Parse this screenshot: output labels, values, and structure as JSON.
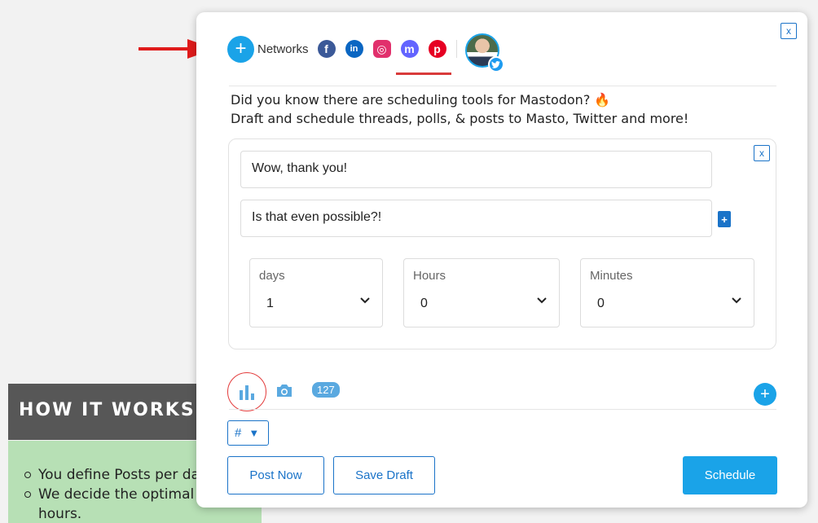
{
  "background_panel": {
    "title": "HOW IT WORKS",
    "items": [
      "You define Posts per day",
      "We decide the optimal d",
      "hours."
    ]
  },
  "composer": {
    "close_label": "x",
    "networks_label": "Networks",
    "add_network_symbol": "+",
    "networks": [
      {
        "name": "facebook-icon",
        "glyph": "f",
        "color": "#3b5998"
      },
      {
        "name": "linkedin-icon",
        "glyph": "in",
        "color": "#0a66c2"
      },
      {
        "name": "instagram-icon",
        "glyph": "◎",
        "color": "#e1306c"
      },
      {
        "name": "mastodon-icon",
        "glyph": "m",
        "color": "#6364ff"
      },
      {
        "name": "pinterest-icon",
        "glyph": "p",
        "color": "#e60023"
      }
    ],
    "selected_account_network": "twitter",
    "promo_line1": "Did you know there are scheduling tools for Mastodon?",
    "promo_emoji": "🔥",
    "promo_line2": "Draft and schedule threads, polls, & posts to Masto, Twitter and more!",
    "poll": {
      "close_label": "x",
      "options": [
        "Wow, thank you!",
        "Is that even possible?!"
      ],
      "add_option_symbol": "+",
      "duration": {
        "days": {
          "label": "days",
          "value": "1"
        },
        "hours": {
          "label": "Hours",
          "value": "0"
        },
        "minutes": {
          "label": "Minutes",
          "value": "0"
        }
      }
    },
    "char_count": "127",
    "add_post_symbol": "+",
    "hashtag_select": "#",
    "hashtag_caret": "▼",
    "buttons": {
      "post_now": "Post Now",
      "save_draft": "Save Draft",
      "schedule": "Schedule"
    },
    "colors": {
      "accent": "#1aa3e8",
      "link_blue": "#1a73c8",
      "highlight_red": "#e33b3b"
    }
  }
}
